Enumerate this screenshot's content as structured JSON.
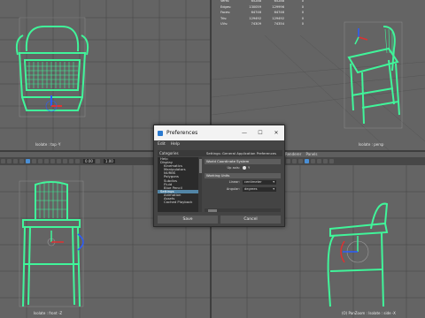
{
  "viewports": {
    "top": {
      "label": "Isolate : top -Y"
    },
    "persp": {
      "label": "Isolate : persp"
    },
    "front": {
      "label": "Isolate : front -Z"
    },
    "side": {
      "label": "Isolate : side -X",
      "prefix": "(O) PanZoom :"
    }
  },
  "hud": {
    "rows": [
      {
        "key": "Verts:",
        "v1": "65288",
        "v2": "65288",
        "v3": "0"
      },
      {
        "key": "Edges:",
        "v1": "130059",
        "v2": "129996",
        "v3": "0"
      },
      {
        "key": "Faces:",
        "v1": "64746",
        "v2": "64746",
        "v3": "0"
      },
      {
        "key": "Tris:",
        "v1": "129492",
        "v2": "129492",
        "v3": "0"
      },
      {
        "key": "UVs:",
        "v1": "74309",
        "v2": "74354",
        "v3": "0"
      }
    ]
  },
  "toolbar": {
    "field1": "0.00",
    "field2": "1.00"
  },
  "right_menu": {
    "renderer": "Renderer",
    "panels": "Panels"
  },
  "dialog": {
    "title": "Preferences",
    "menu": [
      "Edit",
      "Help"
    ],
    "categories_header": "Categories",
    "categories": [
      "Help",
      "Display",
      "Kinematics",
      "Manipulators",
      "NURBS",
      "Polygons",
      "Subdivs",
      "Fluid",
      "Blue Pencil",
      "Settings",
      "Animation",
      "Assets",
      "Cached Playback"
    ],
    "selected_category": "Settings",
    "settings_header": "Settings: General Application Preferences",
    "section1": "World Coordinate System",
    "upaxis_label": "Up axis:",
    "upaxis_value": "Y",
    "section2": "Working Units",
    "linear_label": "Linear:",
    "linear_value": "centimeter",
    "angular_label": "Angular:",
    "angular_value": "degrees",
    "save_label": "Save",
    "cancel_label": "Cancel",
    "min_btn": "—",
    "max_btn": "☐",
    "close_btn": "✕"
  },
  "colors": {
    "mesh": "#40f59a",
    "bg": "#646464",
    "accent": "#5285a6"
  }
}
